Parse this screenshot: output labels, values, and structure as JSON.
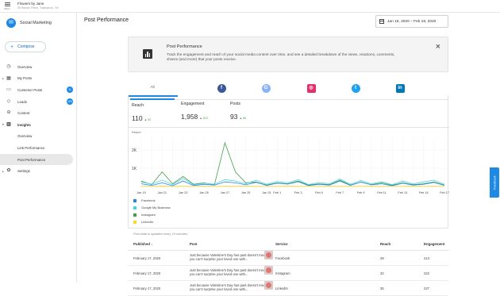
{
  "topbar": {
    "menu_label": "Menu",
    "account_name": "Flowers by Jane",
    "account_address": "55 Barsch Place, Saskatoon, SK"
  },
  "sidebar": {
    "brand": "Social Marketing",
    "compose": "Compose",
    "items": [
      {
        "label": "Overview",
        "icon": "clock-icon"
      },
      {
        "label": "My Posts",
        "icon": "calendar-icon",
        "caret": true
      },
      {
        "label": "Customer Posts",
        "icon": "chat-icon",
        "badge": "11"
      },
      {
        "label": "Leads",
        "icon": "diamond-icon",
        "badge": "100"
      },
      {
        "label": "Content",
        "icon": "link-icon"
      },
      {
        "label": "Insights",
        "icon": "bar-chart-icon",
        "caret": true,
        "bold": true
      },
      {
        "label": "Overview",
        "sub": true
      },
      {
        "label": "Link Performance",
        "sub": true
      },
      {
        "label": "Post Performance",
        "sub": true,
        "active": true
      },
      {
        "label": "Settings",
        "icon": "gear-icon",
        "caret": true
      }
    ]
  },
  "header": {
    "title": "Post Performance",
    "date_range": "Jan 19, 2020 – Feb 18, 2020"
  },
  "info": {
    "title": "Post Performance",
    "text": "Track the engagement and reach of your social media content over time, and see a detailed breakdown of the views, reactions, comments, shares (and more) that your posts receive."
  },
  "tabs": [
    {
      "label": "All",
      "active": true
    },
    {
      "icon": "facebook-icon",
      "glyph": "f",
      "color": "#3b5998"
    },
    {
      "icon": "google-my-business-icon",
      "glyph": "G",
      "color": "#8ab4f8"
    },
    {
      "icon": "instagram-icon",
      "glyph": "◎",
      "color": "#e1306c"
    },
    {
      "icon": "twitter-icon",
      "glyph": "t",
      "color": "#1da1f2"
    },
    {
      "icon": "linkedin-icon",
      "glyph": "in",
      "color": "#0077b5"
    }
  ],
  "metrics": [
    {
      "label": "Reach",
      "value": "110",
      "delta": "▲ 92"
    },
    {
      "label": "Engagement",
      "value": "1,958",
      "delta": "▲ 513"
    },
    {
      "label": "Posts",
      "value": "93",
      "delta": "▲ 65"
    }
  ],
  "chart_data": {
    "type": "line",
    "ylabel": "Reach",
    "yticks": [
      "2K",
      "1K"
    ],
    "ylim": [
      0,
      2700
    ],
    "x": [
      "Jan 19",
      "Jan 20",
      "Jan 21",
      "Jan 22",
      "Jan 23",
      "Jan 24",
      "Jan 25",
      "Jan 26",
      "Jan 27",
      "Jan 28",
      "Jan 29",
      "Jan 30",
      "Jan 31",
      "Feb 1",
      "Feb 2",
      "Feb 3",
      "Feb 4",
      "Feb 5",
      "Feb 6",
      "Feb 7",
      "Feb 8",
      "Feb 9",
      "Feb 10",
      "Feb 11",
      "Feb 12",
      "Feb 13",
      "Feb 14",
      "Feb 15",
      "Feb 16",
      "Feb 17"
    ],
    "xticks": [
      "Jan 19",
      "Jan 21",
      "Jan 23",
      "Jan 25",
      "Jan 27",
      "Jan 29",
      "Jan 31",
      "Feb 1",
      "Feb 3",
      "Feb 5",
      "Feb 7",
      "Feb 9",
      "Feb 11",
      "Feb 13",
      "Feb 15",
      "Feb 17"
    ],
    "grid": true,
    "legend_position": "bottom-left",
    "series": [
      {
        "name": "Facebook",
        "color": "#1e88e5",
        "values": [
          150,
          60,
          200,
          40,
          300,
          50,
          120,
          80,
          250,
          200,
          90,
          230,
          60,
          180,
          130,
          260,
          50,
          120,
          80,
          300,
          60,
          240,
          90,
          150,
          40,
          180,
          80,
          120,
          220,
          60
        ]
      },
      {
        "name": "Google My Business",
        "color": "#4dd0e1",
        "values": [
          250,
          120,
          350,
          100,
          450,
          90,
          180,
          120,
          380,
          300,
          150,
          350,
          120,
          280,
          200,
          380,
          100,
          220,
          150,
          420,
          120,
          330,
          150,
          260,
          100,
          300,
          150,
          250,
          350,
          120
        ]
      },
      {
        "name": "Instagram",
        "color": "#43a047",
        "values": [
          300,
          100,
          800,
          150,
          550,
          120,
          200,
          100,
          2400,
          800,
          200,
          250,
          80,
          200,
          150,
          300,
          80,
          150,
          100,
          350,
          80,
          250,
          100,
          200,
          70,
          200,
          100,
          150,
          250,
          80
        ]
      },
      {
        "name": "LinkedIn",
        "color": "#fdd835",
        "values": [
          20,
          10,
          30,
          10,
          20,
          10,
          30,
          10,
          20,
          10,
          30,
          10,
          20,
          10,
          30,
          10,
          20,
          10,
          30,
          10,
          20,
          10,
          30,
          10,
          20,
          10,
          30,
          10,
          20,
          10
        ]
      }
    ]
  },
  "footnote": "Post data is updated every 15 minutes.",
  "table": {
    "headers": {
      "published": "Published",
      "post": "Post",
      "service": "Service",
      "reach": "Reach",
      "engagement": "Engagement"
    },
    "rows": [
      {
        "published": "February 17, 2020",
        "post": "Just because Valentine's Day has past doesn't mean you can't surprise your loved one with...",
        "service": "Facebook",
        "reach": "28",
        "engagement": "213"
      },
      {
        "published": "February 17, 2020",
        "post": "Just because Valentine's Day has past doesn't mean you can't surprise your loved one with...",
        "service": "Instagram",
        "reach": "32",
        "engagement": "222"
      },
      {
        "published": "February 17, 2020",
        "post": "Just because Valentine's Day has past doesn't mean you can't surprise your loved one with...",
        "service": "LinkedIn",
        "reach": "35",
        "engagement": "227"
      }
    ]
  },
  "feedback": "Feedback"
}
